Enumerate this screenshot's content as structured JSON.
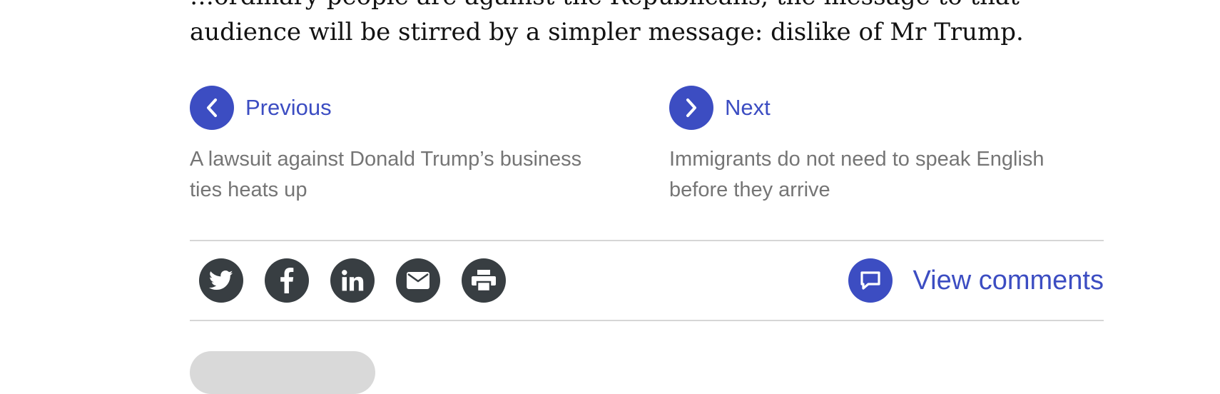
{
  "article": {
    "line_partial": "…ordinary people are against the Republicans, the message to that",
    "last_line": "audience will be stirred by a simpler message: dislike of Mr Trump."
  },
  "pager": {
    "previous_label": "Previous",
    "previous_title": "A lawsuit against Donald Trump’s business ties heats up",
    "next_label": "Next",
    "next_title": "Immigrants do not need to speak English before they arrive"
  },
  "share": {
    "icons": [
      "twitter-icon",
      "facebook-icon",
      "linkedin-icon",
      "email-icon",
      "print-icon"
    ]
  },
  "comments": {
    "label": "View comments"
  },
  "colors": {
    "accent": "#3c4dc2",
    "share_bg": "#383e42",
    "muted_text": "#757575",
    "divider": "#d6d6d6"
  }
}
